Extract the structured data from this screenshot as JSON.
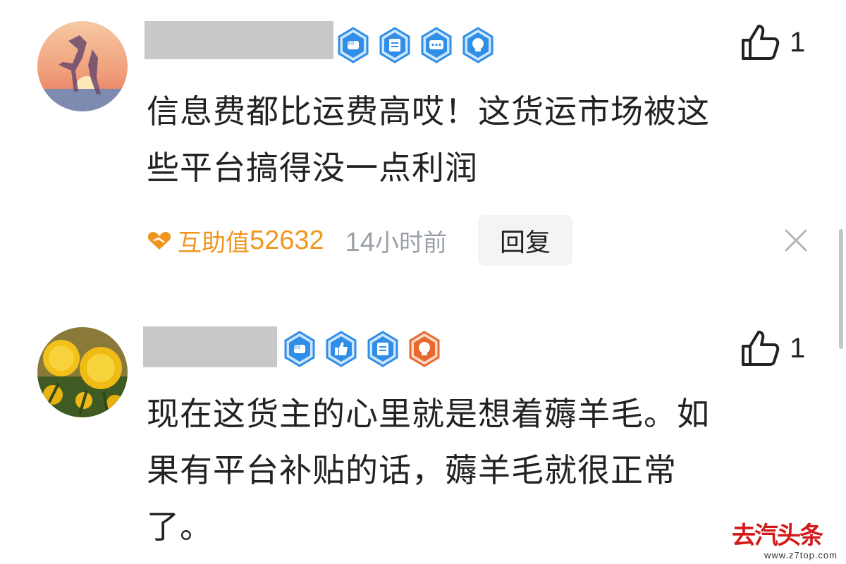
{
  "comments": [
    {
      "name": "",
      "badges": [
        "fist-badge-icon",
        "document-badge-icon",
        "chat-badge-icon",
        "bulb-badge-icon"
      ],
      "likes": "1",
      "text": [
        "信息费都比运费高哎！这货运市场被这",
        "些平台搞得没一点利润"
      ],
      "help_label": "互助值",
      "help_value": "52632",
      "time_num": "14",
      "time_unit": "小时前",
      "reply_label": "回复"
    },
    {
      "name": "",
      "badges": [
        "fist-badge-icon",
        "thumb-badge-icon",
        "document-badge-icon",
        "bulb-badge-orange-icon"
      ],
      "likes": "1",
      "text": [
        "现在这货主的心里就是想着薅羊毛。如",
        "果有平台补贴的话，薅羊毛就很正常",
        "了。"
      ]
    }
  ],
  "watermark": {
    "text": "去汽头条",
    "url": "www.z7top.com"
  },
  "colors": {
    "accent_orange": "#f0961e",
    "badge_blue": "#2f8ee8",
    "badge_orange": "#e8692e",
    "muted_gray": "#9aa0a6"
  }
}
